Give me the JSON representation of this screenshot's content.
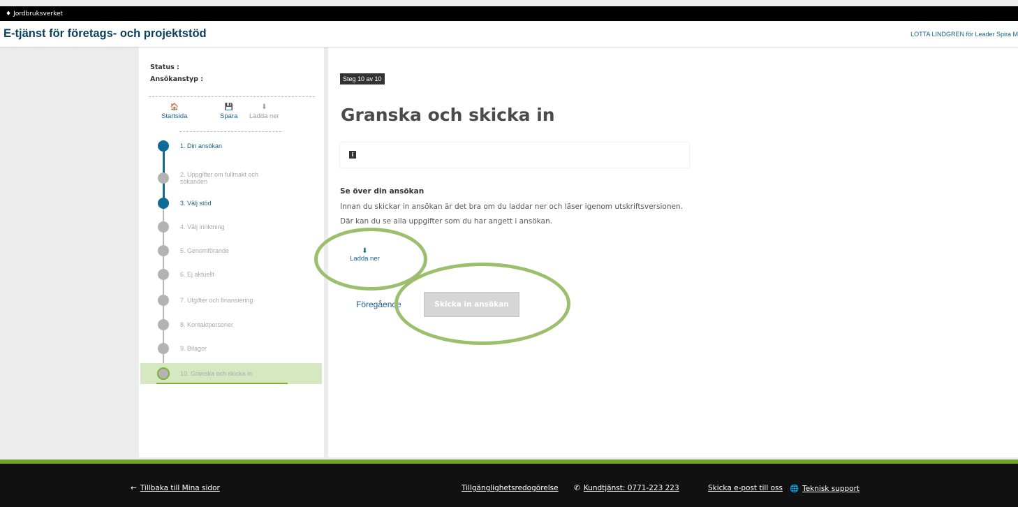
{
  "brand": {
    "name": "Jordbruksverket"
  },
  "header": {
    "title": "E-tjänst för företags- och projektstöd",
    "user": "LOTTA LINDGREN för Leader Spira M"
  },
  "sidebar": {
    "status_label": "Status :",
    "type_label": "Ansökanstyp :",
    "tools": {
      "home": "Startsida",
      "save": "Spara",
      "download": "Ladda ner"
    },
    "steps": [
      {
        "label": "1. Din ansökan",
        "state": "done"
      },
      {
        "label": "2. Uppgifter om fullmakt och sökanden",
        "state": "todo"
      },
      {
        "label": "3. Välj stöd",
        "state": "done"
      },
      {
        "label": "4. Välj inriktning",
        "state": "todo"
      },
      {
        "label": "5. Genomförande",
        "state": "todo"
      },
      {
        "label": "6. Ej aktuellt",
        "state": "todo"
      },
      {
        "label": "7. Utgifter och finansiering",
        "state": "todo"
      },
      {
        "label": "8. Kontaktpersoner",
        "state": "todo"
      },
      {
        "label": "9. Bilagor",
        "state": "todo"
      },
      {
        "label": "10. Granska och skicka in",
        "state": "current"
      }
    ]
  },
  "main": {
    "step_badge": "Steg 10 av 10",
    "title": "Granska och skicka in",
    "section_title": "Se över din ansökan",
    "para1": "Innan du skickar in ansökan är det bra om du laddar ner och läser igenom utskriftsversionen.",
    "para2": "Där kan du se alla uppgifter som du har angett i ansökan.",
    "download_label": "Ladda ner",
    "prev_label": "Föregående",
    "submit_label": "Skicka in ansökan"
  },
  "footer": {
    "back": "Tillbaka till Mina sidor",
    "accessibility": "Tillgänglighetsredogörelse",
    "phone": "Kundtjänst: 0771-223 223",
    "email": "Skicka e-post till oss",
    "support": "Teknisk support"
  },
  "colors": {
    "accent": "#1a5f8a",
    "done_step": "#0e6a96",
    "green": "#7fb02e",
    "highlight": "#9bbf6c"
  }
}
